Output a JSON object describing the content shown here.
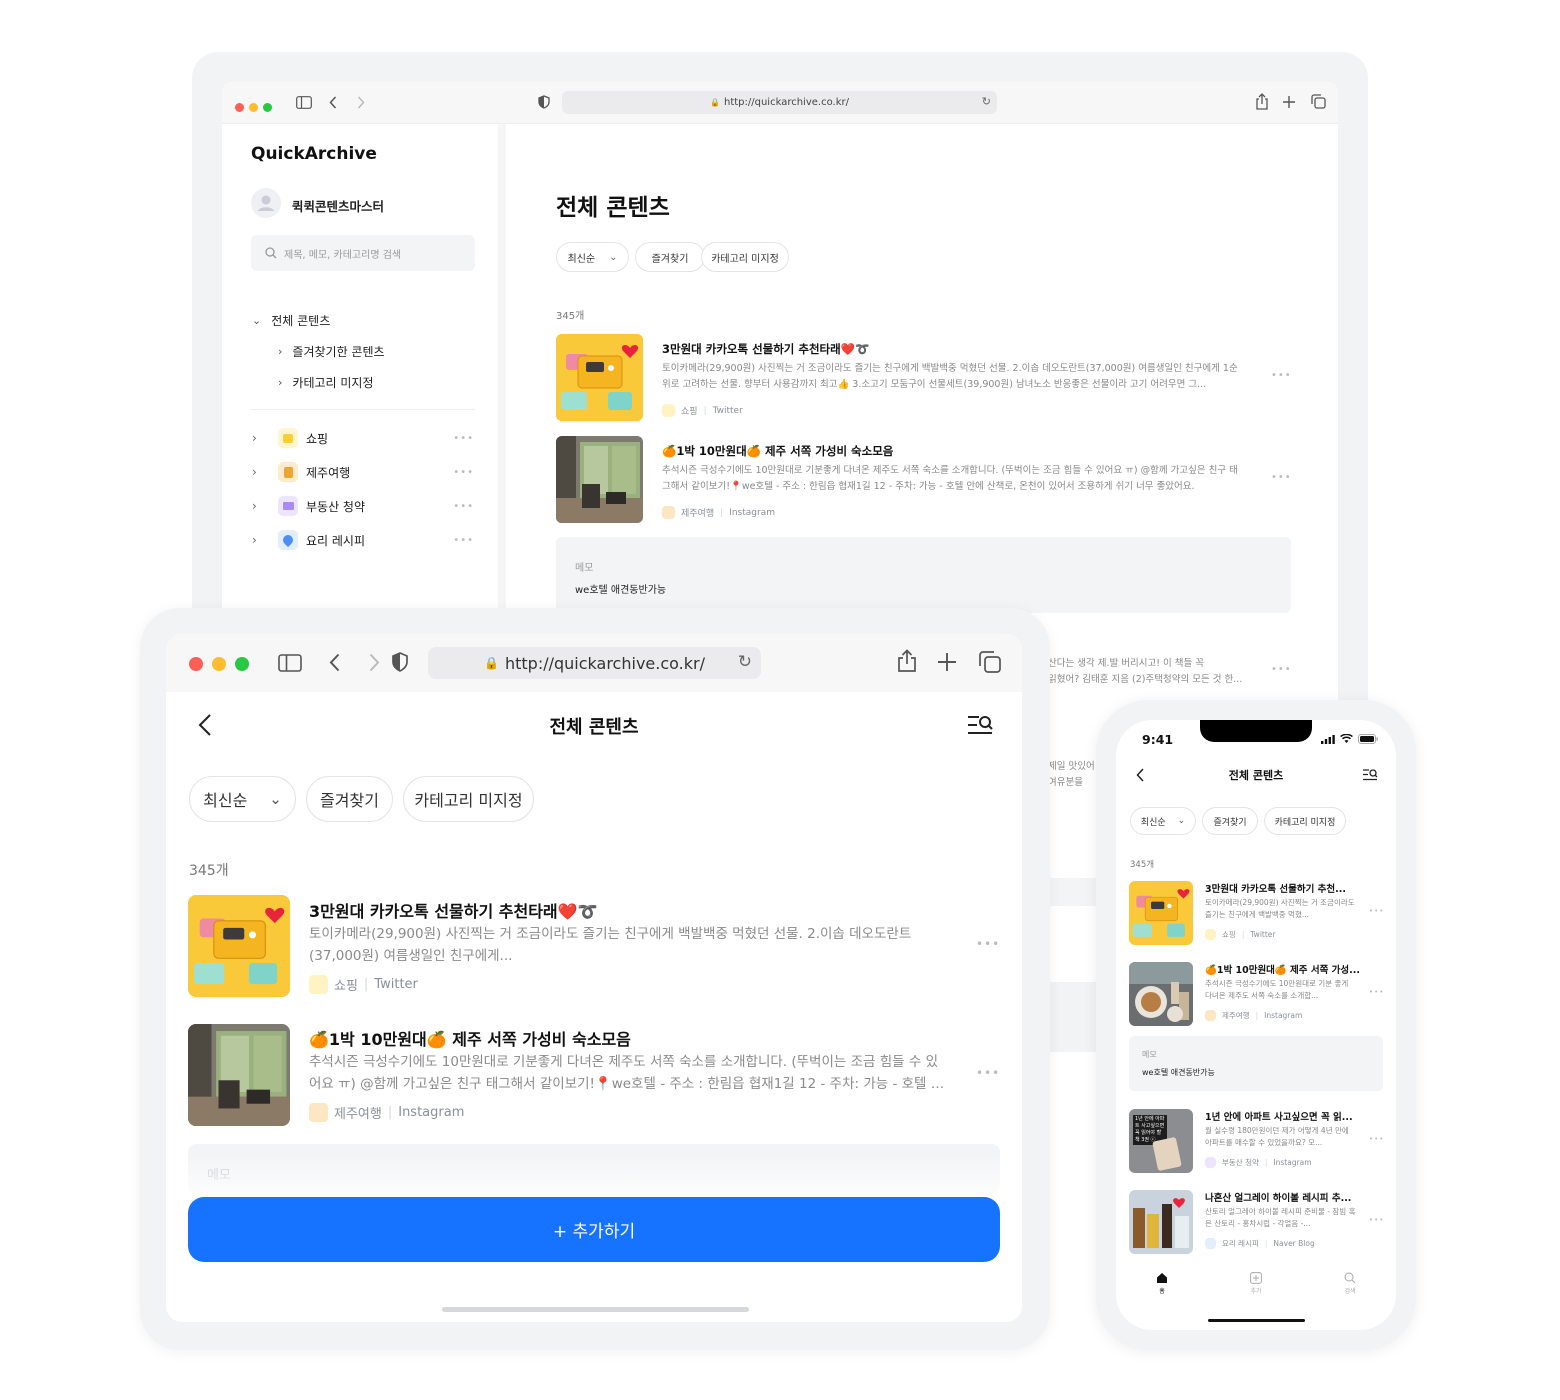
{
  "colors": {
    "primary": "#1673ff",
    "cat_shopping": "#ffd84a",
    "cat_jeju": "#f5b43d",
    "cat_realestate": "#a98af7",
    "cat_recipe": "#4b8ff6"
  },
  "desktop": {
    "url": "http://quickarchive.co.kr/",
    "logo": "QuickArchive",
    "username": "퀵퀵콘텐츠마스터",
    "search_placeholder": "제목, 메모, 카테고리명 검색",
    "tree": {
      "root": "전체 콘텐츠",
      "children": [
        "즐겨찾기한 콘텐츠",
        "카테고리 미지정"
      ]
    },
    "categories": [
      {
        "label": "쇼핑",
        "icon": "shopping-bag-icon"
      },
      {
        "label": "제주여행",
        "icon": "tangerine-icon"
      },
      {
        "label": "부동산 청약",
        "icon": "folder-icon"
      },
      {
        "label": "요리 레시피",
        "icon": "water-drop-icon"
      }
    ],
    "page_title": "전체 콘텐츠",
    "filters": {
      "sort": "최신순",
      "favorite": "즐겨찾기",
      "uncategorized": "카테고리 미지정"
    },
    "count": "345개",
    "items": [
      {
        "title": "3만원대 카카오톡 선물하기 추천타래❤️➰",
        "desc": "토이카메라(29,900원) 사진찍는 거 조금이라도 즐기는 친구에게 백발백중 먹혔던 선물. 2.이솝 데오도란트(37,000원) 여름생일인 친구에게 1순위로 고려하는 선물. 향부터 사용감까지 최고👍 3.소고기 모둠구이 선물세트(39,900원) 남녀노소 반응좋은 선물이라 고기 어려우면 그...",
        "category": "쇼핑",
        "source": "Twitter"
      },
      {
        "title": "🍊1박 10만원대🍊 제주 서쪽 가성비 숙소모음",
        "desc": "추석시즌 극성수기에도 10만원대로 기분좋게 다녀온 제주도 서쪽 숙소를 소개합니다. (뚜벅이는 조금 힘들 수 있어요 ㅠ) @함께 가고싶은 친구 태그해서 같이보기!📍we호텔 - 주소 : 한림읍 협재1길 12 - 주차: 가능 - 호텔 안에 산책로, 온천이 있어서 조용하게 쉬기 너무 좋았어요.",
        "category": "제주여행",
        "source": "Instagram"
      }
    ],
    "memo_label": "메모",
    "memo_text": "we호텔 애견동반가능",
    "partial_lines": {
      "a1": "산다는 생각 제.발 버리시고! 이 책들 꼭",
      "a2": "읽혔어? 김태훈 지음 (2)주택청약의 모든 것 한...",
      "b1": "제일 맛있어",
      "b2": "여유분을"
    }
  },
  "tablet": {
    "url": "http://quickarchive.co.kr/",
    "title": "전체 콘텐츠",
    "filters": {
      "sort": "최신순",
      "favorite": "즐겨찾기",
      "uncategorized": "카테고리 미지정"
    },
    "count": "345개",
    "items": [
      {
        "title": "3만원대 카카오톡 선물하기 추천타래❤️➰",
        "desc": "토이카메라(29,900원) 사진찍는 거 조금이라도 즐기는 친구에게 백발백중 먹혔던 선물. 2.이솝 데오도란트(37,000원) 여름생일인 친구에게...",
        "category": "쇼핑",
        "source": "Twitter"
      },
      {
        "title": "🍊1박 10만원대🍊 제주 서쪽 가성비 숙소모음",
        "desc": "추석시즌 극성수기에도 10만원대로 기분좋게 다녀온 제주도 서쪽 숙소를 소개합니다. (뚜벅이는 조금 힘들 수 있어요 ㅠ) @함께 가고싶은 친구 태그해서 같이보기!📍we호텔 - 주소 : 한림읍 협재1길 12 - 주차: 가능 - 호텔 안에...",
        "category": "제주여행",
        "source": "Instagram"
      }
    ],
    "memo_label": "메모",
    "add_button": "+ 추가하기"
  },
  "phone": {
    "time": "9:41",
    "title": "전체 콘텐츠",
    "filters": {
      "sort": "최신순",
      "favorite": "즐겨찾기",
      "uncategorized": "카테고리 미지정"
    },
    "count": "345개",
    "items": [
      {
        "title": "3만원대 카카오톡 선물하기 추천...",
        "desc": "토이카메라(29,900원) 사진찍는 거 조금이라도 즐기는 친구에게 백발백중 먹혔...",
        "category": "쇼핑",
        "source": "Twitter"
      },
      {
        "title": "🍊1박 10만원대🍊 제주 서쪽 가성...",
        "desc": "추석시즌 극성수기에도 10만원대로 기분 좋게 다녀온 제주도 서쪽 숙소를 소개합...",
        "category": "제주여행",
        "source": "Instagram"
      },
      {
        "title": "1년 안에 아파트 사고싶으면 꼭 읽...",
        "desc": "월 실수령 180만원이던 제가 어떻게 4년 만에 아파트를 매수할 수 있었을까요? 모...",
        "category": "부동산 청약",
        "source": "Instagram"
      },
      {
        "title": "나혼산 얼그레이 하이볼 레시피 추...",
        "desc": "산토리 얼그레이 하이볼 레시피 준비물 - 잠빔 혹은 산토리 - 홍차시럽 - 각얼음 -...",
        "category": "요리 레시피",
        "source": "Naver Blog"
      }
    ],
    "memo_label": "메모",
    "memo_text": "we호텔 애견동반가능",
    "thumb3_text": "1년 안에 아파트 사고싶으면 꼭 읽어야 할 책 3권 ⓒ",
    "tabs": [
      "홈",
      "추가",
      "검색"
    ]
  }
}
